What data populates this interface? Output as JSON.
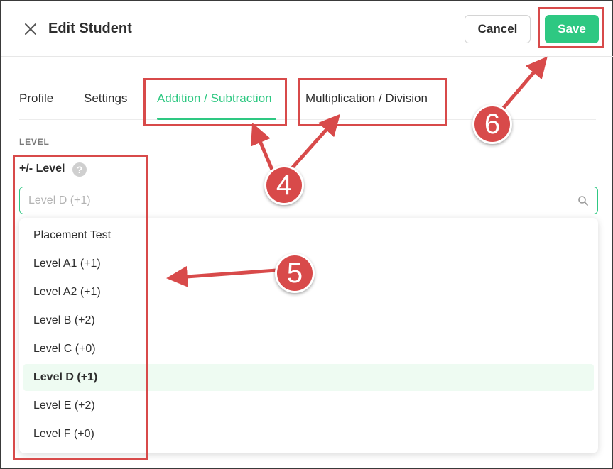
{
  "header": {
    "title": "Edit Student",
    "cancel_label": "Cancel",
    "save_label": "Save"
  },
  "tabs": [
    {
      "label": "Profile",
      "active": false
    },
    {
      "label": "Settings",
      "active": false
    },
    {
      "label": "Addition / Subtraction",
      "active": true
    },
    {
      "label": "Multiplication / Division",
      "active": false
    }
  ],
  "section": {
    "label": "LEVEL",
    "field_label": "+/- Level",
    "help": "?"
  },
  "select": {
    "placeholder": "Level D (+1)",
    "value": ""
  },
  "options": [
    {
      "label": "Placement Test",
      "selected": false
    },
    {
      "label": "Level A1 (+1)",
      "selected": false
    },
    {
      "label": "Level A2 (+1)",
      "selected": false
    },
    {
      "label": "Level B (+2)",
      "selected": false
    },
    {
      "label": "Level C (+0)",
      "selected": false
    },
    {
      "label": "Level D (+1)",
      "selected": true
    },
    {
      "label": "Level E (+2)",
      "selected": false
    },
    {
      "label": "Level F (+0)",
      "selected": false
    }
  ],
  "annotations": {
    "step_tabs": "4",
    "step_options": "5",
    "step_save": "6"
  },
  "colors": {
    "accent": "#2ec882",
    "annotation": "#d84a4a",
    "selected_bg": "#eefbf2"
  }
}
